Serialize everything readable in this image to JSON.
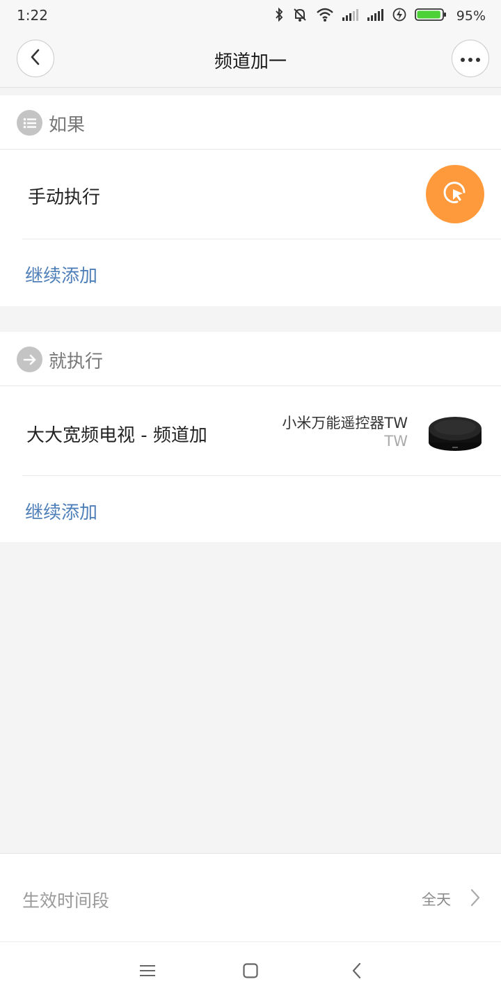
{
  "status_bar": {
    "time": "1:22",
    "battery": "95%",
    "icons": [
      "bluetooth-icon",
      "mute-icon",
      "wifi-icon",
      "signal-icon",
      "signal-icon",
      "charging-icon",
      "battery-icon"
    ],
    "battery_level": 0.95,
    "battery_color": "#4cd137"
  },
  "header": {
    "title": "频道加一",
    "back_icon": "back-arrow-icon",
    "more_icon": "more-icon"
  },
  "if_section": {
    "title": "如果",
    "icon": "list-icon",
    "condition": "手动执行",
    "condition_icon": "click-pointer-icon",
    "add_label": "继续添加"
  },
  "then_section": {
    "title": "就执行",
    "icon": "arrow-right-icon",
    "action": "大大宽频电视 - 频道加",
    "device_name": "小米万能遥控器TW",
    "device_room": "TW",
    "add_label": "继续添加"
  },
  "time_period": {
    "label": "生效时间段",
    "value": "全天"
  },
  "navbar": {
    "icons": [
      "menu-icon",
      "home-icon",
      "back-icon"
    ]
  },
  "colors": {
    "accent_orange": "#ff9a3c",
    "link_blue": "#4f7fb8"
  }
}
